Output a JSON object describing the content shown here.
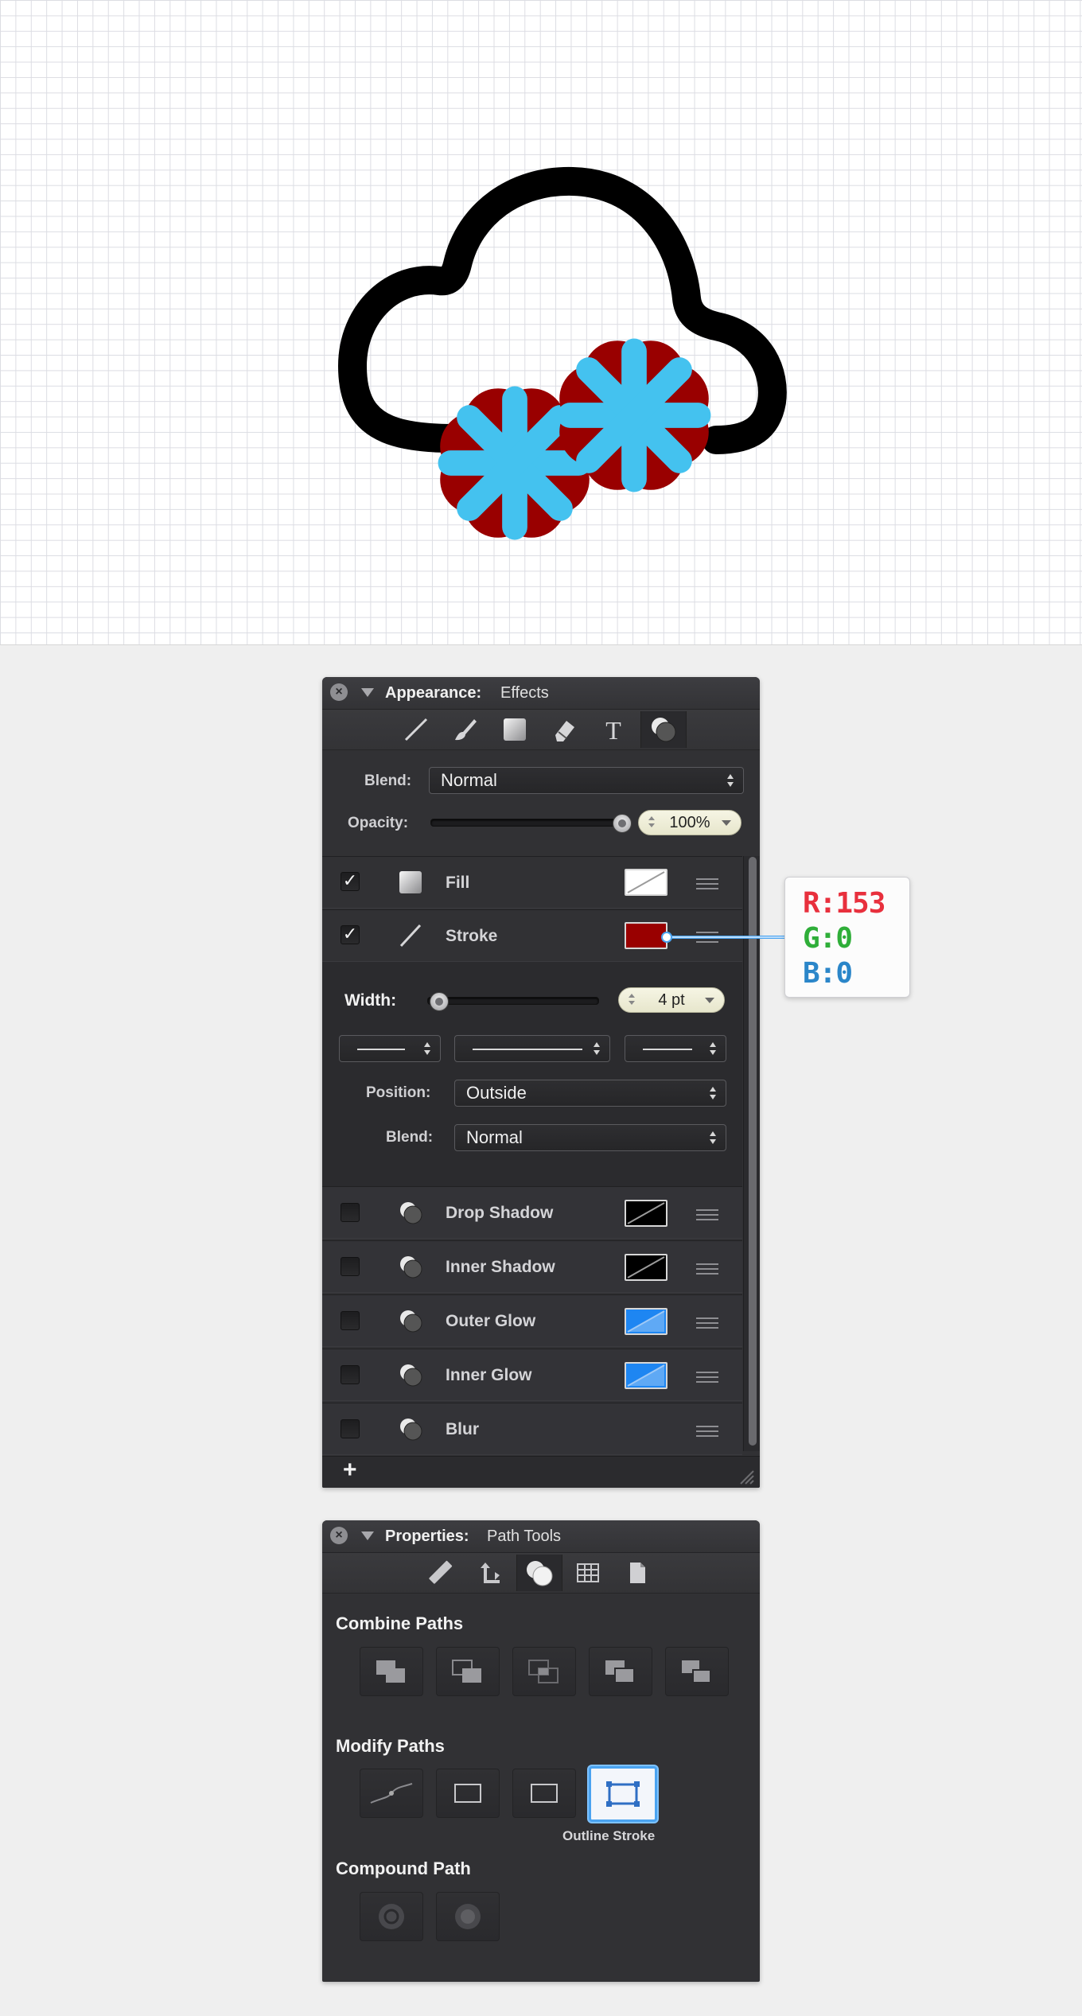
{
  "colors": {
    "snowflake_fill": "#44c2ef",
    "snowflake_stroke": "#990000",
    "cloud_stroke": "#000000",
    "panel_bg": "#313134",
    "selection_blue": "#4aa3f0"
  },
  "appearance": {
    "title": "Appearance:",
    "subtitle": "Effects",
    "tabs": [
      "line-tool-icon",
      "brush-icon",
      "fill-icon",
      "eraser-icon",
      "text-icon",
      "effects-icon"
    ],
    "blend_label": "Blend:",
    "blend_value": "Normal",
    "opacity_label": "Opacity:",
    "opacity_value": "100%",
    "opacity_level": 1.0,
    "fill": {
      "label": "Fill",
      "checked": true
    },
    "stroke": {
      "label": "Stroke",
      "checked": true,
      "color": "#990000"
    },
    "stroke_options": {
      "width_label": "Width:",
      "width_value": "4 pt",
      "position_label": "Position:",
      "position_value": "Outside",
      "blend_label": "Blend:",
      "blend_value": "Normal"
    },
    "effects": [
      {
        "label": "Drop Shadow",
        "checked": false,
        "swatch": "black"
      },
      {
        "label": "Inner Shadow",
        "checked": false,
        "swatch": "black"
      },
      {
        "label": "Outer Glow",
        "checked": false,
        "swatch": "blue"
      },
      {
        "label": "Inner Glow",
        "checked": false,
        "swatch": "blue"
      },
      {
        "label": "Blur",
        "checked": false,
        "swatch": "none"
      }
    ],
    "add_label": "+"
  },
  "callout": {
    "r": "R:153",
    "g": "G:0",
    "b": "B:0"
  },
  "properties": {
    "title": "Properties:",
    "subtitle": "Path Tools",
    "tabs": [
      "ruler-icon",
      "transform-icon",
      "path-tools-icon",
      "grid-icon",
      "document-icon"
    ],
    "combine_title": "Combine Paths",
    "modify_title": "Modify Paths",
    "outline_stroke_label": "Outline Stroke",
    "compound_title": "Compound Path"
  }
}
